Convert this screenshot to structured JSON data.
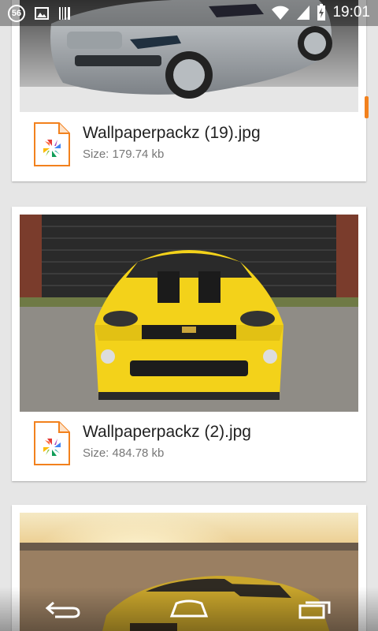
{
  "status_bar": {
    "notification_count": "56",
    "time": "19:01"
  },
  "files": [
    {
      "name": "Wallpaperpackz (19).jpg",
      "size": "Size: 179.74 kb"
    },
    {
      "name": "Wallpaperpackz (2).jpg",
      "size": "Size: 484.78 kb"
    }
  ],
  "colors": {
    "accent": "#f2811d"
  }
}
